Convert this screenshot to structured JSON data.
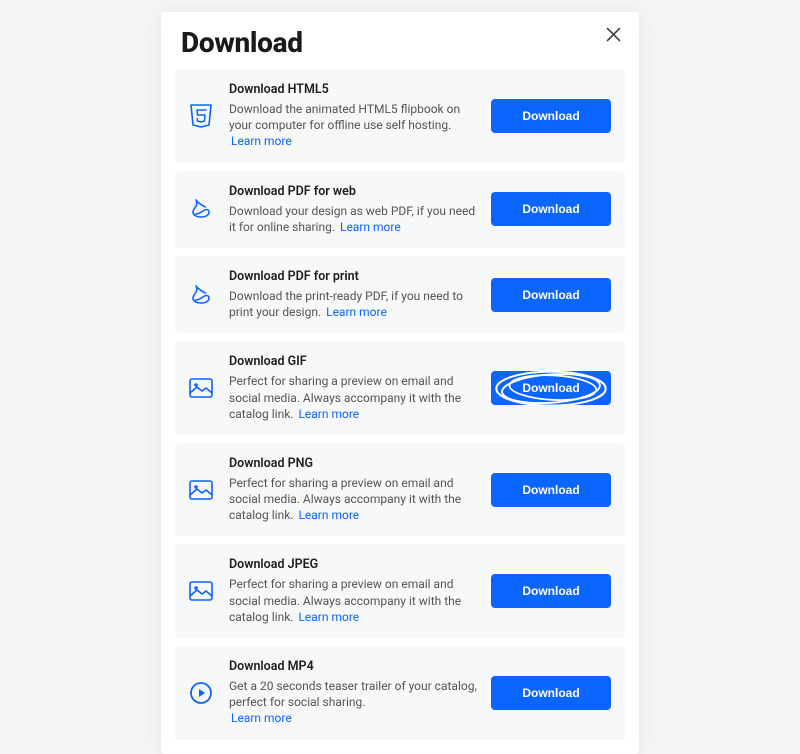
{
  "modal": {
    "title": "Download",
    "close_label": "Close",
    "dl_label": "Download",
    "learn_more_label": "Learn more",
    "options": [
      {
        "icon": "html5",
        "title": "Download HTML5",
        "desc": "Download the animated HTML5 flipbook on your computer for offline use self hosting.",
        "learn_more_inline": false
      },
      {
        "icon": "pdf",
        "title": "Download PDF for web",
        "desc": "Download your design as web PDF, if you need it for online sharing.",
        "learn_more_inline": true
      },
      {
        "icon": "pdf",
        "title": "Download PDF for print",
        "desc": "Download the print-ready PDF, if you need to print your design.",
        "learn_more_inline": true
      },
      {
        "icon": "image",
        "title": "Download GIF",
        "desc": "Perfect for sharing a preview on email and social media. Always accompany it with the catalog link.",
        "learn_more_inline": true,
        "highlighted": true
      },
      {
        "icon": "image",
        "title": "Download PNG",
        "desc": "Perfect for sharing a preview on email and social media. Always accompany it with the catalog link.",
        "learn_more_inline": true
      },
      {
        "icon": "image",
        "title": "Download JPEG",
        "desc": "Perfect for sharing a preview on email and social media. Always accompany it with the catalog link.",
        "learn_more_inline": true
      },
      {
        "icon": "play",
        "title": "Download MP4",
        "desc": "Get a 20 seconds teaser trailer of your catalog, perfect for social sharing.",
        "learn_more_inline": false
      }
    ]
  }
}
